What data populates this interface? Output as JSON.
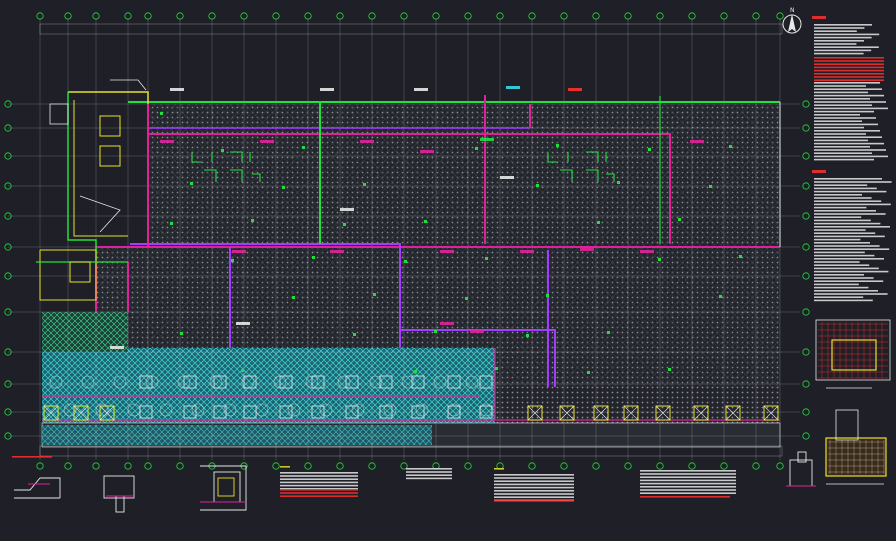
{
  "drawing": {
    "background": "#1e1f27",
    "colors": {
      "grid": "#d8d8d8",
      "beam_magenta": "#e0229a",
      "beam_purple": "#a33cff",
      "green": "#22e03c",
      "yellow": "#e8e02a",
      "cyan": "#37d8e8",
      "red": "#ff3030",
      "white": "#e8e8e8"
    },
    "north_symbol_letter": "N",
    "icons": [
      "north-arrow-icon"
    ]
  }
}
